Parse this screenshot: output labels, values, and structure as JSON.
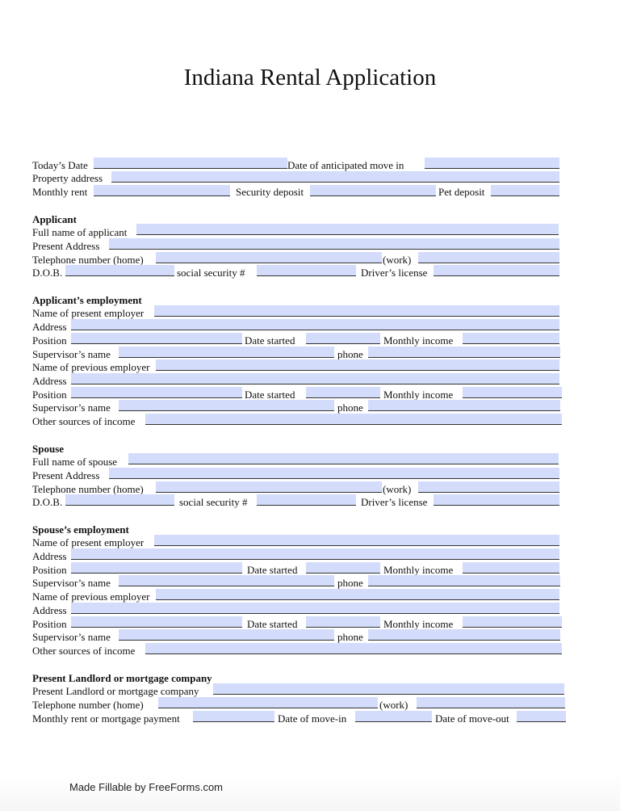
{
  "title": "Indiana Rental Application",
  "general": {
    "todays_date": "Today’s Date",
    "move_in": "Date of anticipated move in",
    "property_address": "Property address",
    "monthly_rent": "Monthly rent",
    "security_deposit": "Security deposit",
    "pet_deposit": "Pet deposit"
  },
  "applicant": {
    "heading": "Applicant",
    "full_name": "Full name of applicant",
    "present_address": "Present Address",
    "tel_home": "Telephone number (home)",
    "work": "(work)",
    "dob": "D.O.B.",
    "ssn": "social security #",
    "drivers_license": "Driver’s license"
  },
  "applicant_employment": {
    "heading": "Applicant’s employment",
    "present_employer": "Name of present employer",
    "address": "Address",
    "position": "Position",
    "date_started": "Date started",
    "monthly_income": "Monthly income",
    "supervisor": "Supervisor’s name",
    "phone": "phone",
    "previous_employer": "Name of previous employer",
    "other_income": "Other sources of income"
  },
  "spouse": {
    "heading": "Spouse",
    "full_name": "Full name of spouse",
    "present_address": "Present Address",
    "tel_home": "Telephone number (home)",
    "work": "(work)",
    "dob": "D.O.B.",
    "ssn": "social security #",
    "drivers_license": "Driver’s license"
  },
  "spouse_employment": {
    "heading": "Spouse’s employment",
    "present_employer": "Name of present employer",
    "address": "Address",
    "position": "Position",
    "date_started": "Date started",
    "monthly_income": "Monthly income",
    "supervisor": "Supervisor’s name",
    "phone": "phone",
    "previous_employer": "Name of previous employer",
    "other_income": "Other sources of income"
  },
  "landlord": {
    "heading": "Present Landlord or mortgage company",
    "company": "Present Landlord or mortgage company",
    "tel_home": "Telephone number (home)",
    "work": "(work)",
    "payment": "Monthly rent or mortgage payment",
    "move_in": "Date of move-in",
    "move_out": "Date of move-out"
  },
  "footer": "Made Fillable by FreeForms.com",
  "colors": {
    "field_fill": "#d3dcfb",
    "underline": "#333333"
  }
}
